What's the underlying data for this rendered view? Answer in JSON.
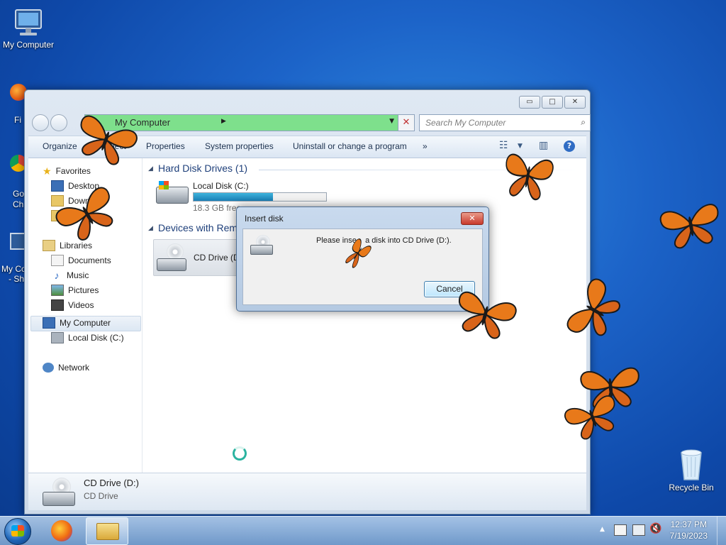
{
  "desktop": {
    "icons": [
      {
        "label": "My Computer"
      },
      {
        "label": "Recycle Bin"
      }
    ],
    "partial_labels": [
      "Fi",
      "Go",
      "Ch",
      "My Co",
      "- Sh"
    ]
  },
  "window": {
    "title_buttons": {
      "minimize": "▭",
      "maximize": "□",
      "close": "✕"
    },
    "address": {
      "path": "My Computer"
    },
    "search": {
      "placeholder": "Search My Computer"
    },
    "toolbar": {
      "organize": "Organize",
      "eject": "Eject",
      "properties": "Properties",
      "system_properties": "System properties",
      "uninstall": "Uninstall or change a program",
      "more": "»"
    },
    "nav": {
      "favorites": "Favorites",
      "desktop": "Desktop",
      "downloads": "Downlo",
      "recent": "Recent",
      "libraries": "Libraries",
      "documents": "Documents",
      "music": "Music",
      "pictures": "Pictures",
      "videos": "Videos",
      "my_computer": "My Computer",
      "local_disk": "Local Disk (C:)",
      "network": "Network"
    },
    "groups": {
      "hdd": "Hard Disk Drives (1)",
      "removable": "Devices with Rem"
    },
    "drives": {
      "local_name": "Local Disk (C:)",
      "local_free": "18.3 GB free",
      "local_used_fraction": 0.6,
      "cd_name": "CD Drive (D"
    },
    "details": {
      "name": "CD Drive (D:)",
      "type": "CD Drive"
    }
  },
  "dialog": {
    "title": "Insert disk",
    "close": "✕",
    "message": "Please inse    a disk into CD Drive (D:).",
    "cancel": "Cancel"
  },
  "taskbar": {
    "time": "12:37 PM",
    "date": "7/19/2023",
    "tray_arrow": "▲"
  }
}
